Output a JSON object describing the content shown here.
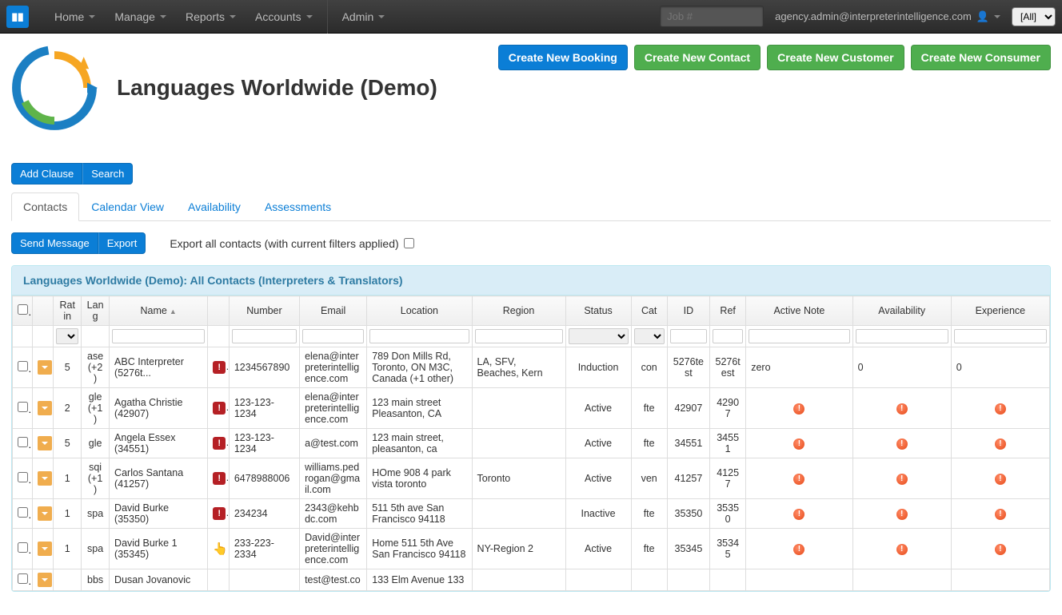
{
  "navbar": {
    "items": [
      "Home",
      "Manage",
      "Reports",
      "Accounts"
    ],
    "admin": "Admin",
    "job_placeholder": "Job #",
    "user_email": "agency.admin@interpreterintelligence.com",
    "all_label": "[All]"
  },
  "page": {
    "title": "Languages Worldwide (Demo)"
  },
  "actions": {
    "new_booking": "Create New Booking",
    "new_contact": "Create New Contact",
    "new_customer": "Create New Customer",
    "new_consumer": "Create New Consumer"
  },
  "toolbar": {
    "add_clause": "Add Clause",
    "search": "Search"
  },
  "tabs": [
    "Contacts",
    "Calendar View",
    "Availability",
    "Assessments"
  ],
  "sub_toolbar": {
    "send_message": "Send Message",
    "export": "Export",
    "export_all_label": "Export all contacts (with current filters applied)"
  },
  "panel": {
    "heading": "Languages Worldwide (Demo): All Contacts (Interpreters & Translators)"
  },
  "columns": {
    "rating": "Ratin",
    "lang": "Lang",
    "name": "Name",
    "number": "Number",
    "email": "Email",
    "location": "Location",
    "region": "Region",
    "status": "Status",
    "cat": "Cat",
    "id": "ID",
    "ref": "Ref",
    "note": "Active Note",
    "avail": "Availability",
    "exp": "Experience"
  },
  "rows": [
    {
      "rating": "5",
      "lang": "ase (+2)",
      "name": "ABC Interpreter (5276t...",
      "flag": "red",
      "number": "1234567890",
      "email": "elena@interpreterintelligence.com",
      "location": "789 Don Mills Rd, Toronto, ON M3C, Canada (+1 other)",
      "region": "LA, SFV, Beaches, Kern",
      "status": "Induction",
      "cat": "con",
      "id": "5276test",
      "ref": "5276test",
      "note": "zero",
      "avail": "0",
      "exp": "0"
    },
    {
      "rating": "2",
      "lang": "gle (+1)",
      "name": "Agatha Christie (42907)",
      "flag": "red",
      "number": "123-123-1234",
      "email": "elena@interpreterintelligence.com",
      "location": "123 main street Pleasanton, CA",
      "region": "",
      "status": "Active",
      "cat": "fte",
      "id": "42907",
      "ref": "42907",
      "note": "warn",
      "avail": "warn",
      "exp": "warn"
    },
    {
      "rating": "5",
      "lang": "gle",
      "name": "Angela Essex (34551)",
      "flag": "red",
      "number": "123-123-1234",
      "email": "a@test.com",
      "location": "123 main street, pleasanton, ca",
      "region": "",
      "status": "Active",
      "cat": "fte",
      "id": "34551",
      "ref": "34551",
      "note": "warn",
      "avail": "warn",
      "exp": "warn"
    },
    {
      "rating": "1",
      "lang": "sqi (+1)",
      "name": "Carlos Santana (41257)",
      "flag": "red",
      "number": "6478988006",
      "email": "williams.pedrogan@gmail.com",
      "location": "HOme 908 4 park vista toronto",
      "region": "Toronto",
      "status": "Active",
      "cat": "ven",
      "id": "41257",
      "ref": "41257",
      "note": "warn",
      "avail": "warn",
      "exp": "warn"
    },
    {
      "rating": "1",
      "lang": "spa",
      "name": "David Burke (35350)",
      "flag": "red",
      "number": "234234",
      "email": "2343@kehbdc.com",
      "location": "511 5th ave San Francisco 94118",
      "region": "",
      "status": "Inactive",
      "cat": "fte",
      "id": "35350",
      "ref": "35350",
      "note": "warn",
      "avail": "warn",
      "exp": "warn"
    },
    {
      "rating": "1",
      "lang": "spa",
      "name": "David Burke 1 (35345)",
      "flag": "hand",
      "number": "233-223-2334",
      "email": "David@interpreterintelligence.com",
      "location": "Home 511 5th Ave San Francisco 94118",
      "region": "NY-Region 2",
      "status": "Active",
      "cat": "fte",
      "id": "35345",
      "ref": "35345",
      "note": "warn",
      "avail": "warn",
      "exp": "warn"
    },
    {
      "rating": "",
      "lang": "bbs",
      "name": "Dusan Jovanovic",
      "flag": "",
      "number": "",
      "email": "test@test.co",
      "location": "133 Elm Avenue 133",
      "region": "",
      "status": "",
      "cat": "",
      "id": "",
      "ref": "",
      "note": "",
      "avail": "",
      "exp": ""
    }
  ]
}
